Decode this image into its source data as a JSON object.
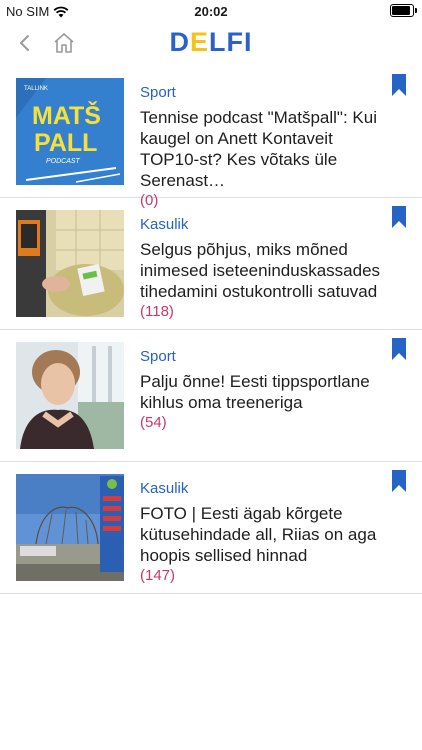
{
  "status_bar": {
    "carrier": "No SIM",
    "time": "20:02"
  },
  "header": {
    "logo": [
      "D",
      "E",
      "L",
      "F",
      "I"
    ]
  },
  "articles": [
    {
      "category": "Sport",
      "title": "Tennise podcast \"Matšpall\": Kui kaugel on Anett Kontaveit TOP10-st? Kes võtaks üle Serenast…",
      "comments": "(0)",
      "thumb_text": {
        "small": "TALLINK",
        "line1": "MATŠ",
        "line2": "PALL",
        "line3": "PODCAST"
      }
    },
    {
      "category": "Kasulik",
      "title": "Selgus põhjus, miks mõned inimesed iseteeninduskassades tihedamini ostukontrolli satuvad",
      "comments": "(118)"
    },
    {
      "category": "Sport",
      "title": "Palju õnne! Eesti tippsportlane kihlus oma treeneriga",
      "comments": "(54)"
    },
    {
      "category": "Kasulik",
      "title": "FOTO | Eesti ägab kõrgete kütusehindade all, Riias on aga hoopis sellised hinnad",
      "comments": "(147)"
    }
  ],
  "colors": {
    "accent_blue": "#2563c4",
    "comments_pink": "#c8386a",
    "logo_blue": "#2a62c9",
    "logo_yellow": "#f3c315"
  }
}
